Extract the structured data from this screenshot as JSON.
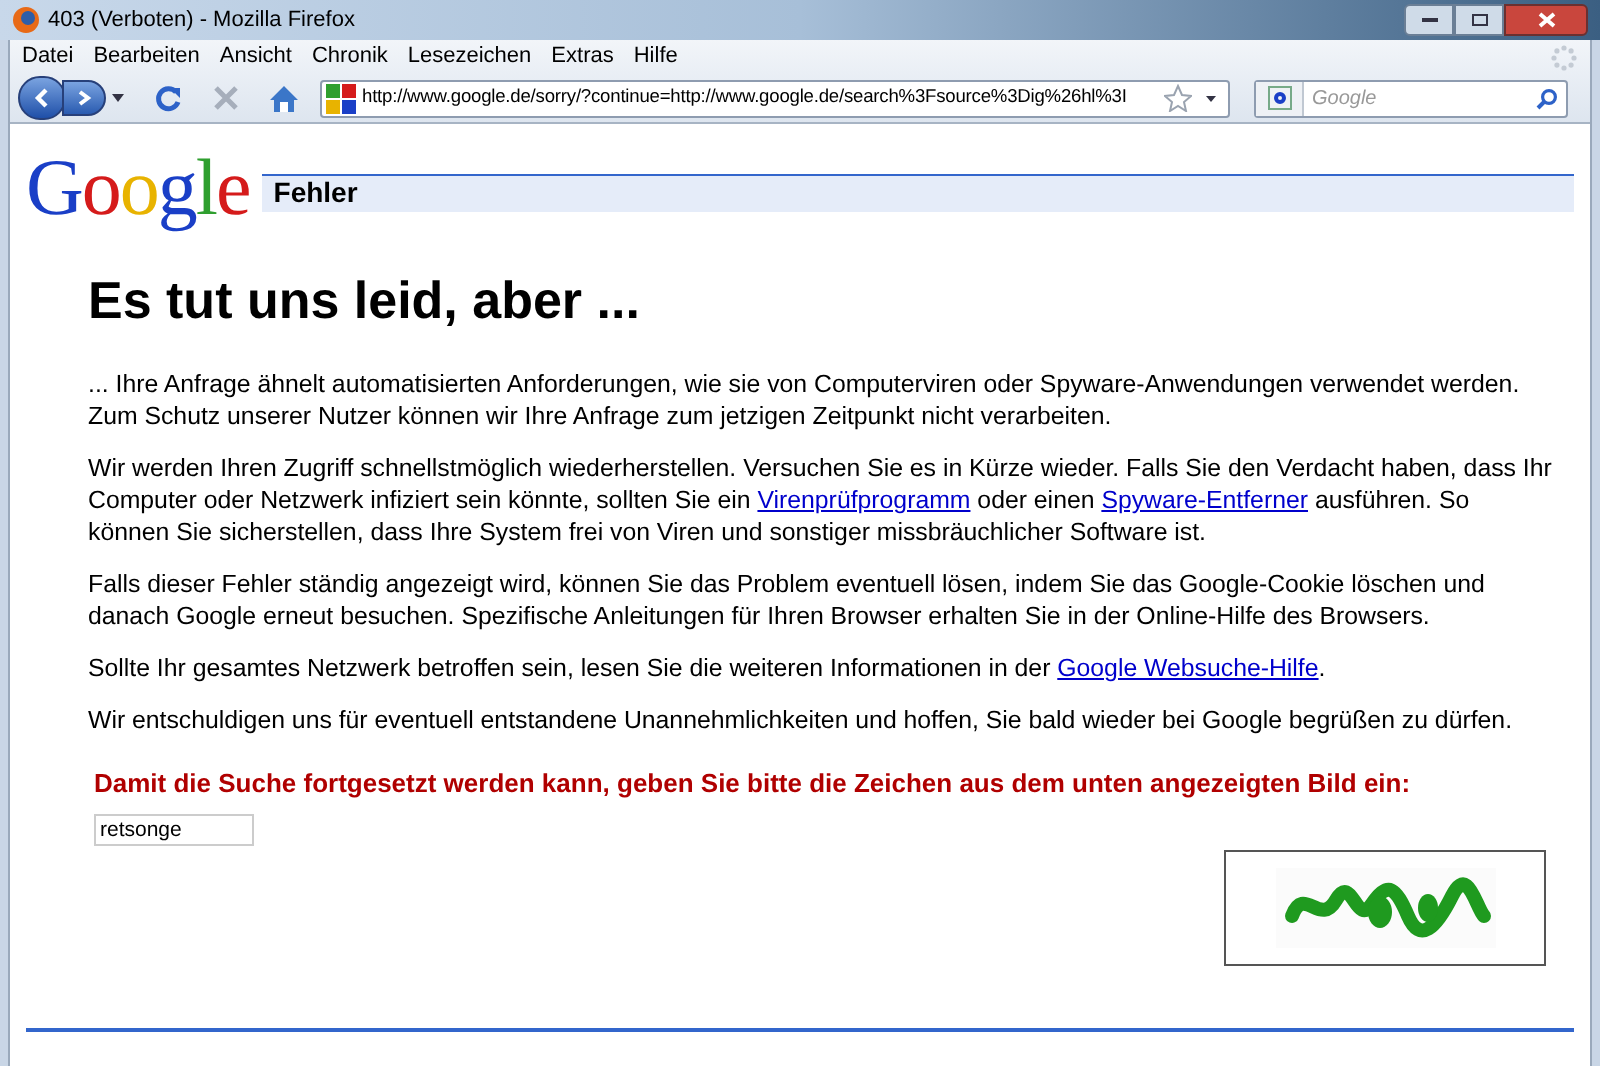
{
  "window": {
    "title": "403 (Verboten) - Mozilla Firefox"
  },
  "menu": [
    "Datei",
    "Bearbeiten",
    "Ansicht",
    "Chronik",
    "Lesezeichen",
    "Extras",
    "Hilfe"
  ],
  "address_bar": {
    "value": "http://www.google.de/sorry/?continue=http://www.google.de/search%3Fsource%3Dig%26hl%3I"
  },
  "search_box": {
    "placeholder": "Google"
  },
  "page": {
    "logo": [
      {
        "char": "G",
        "color": "#1a3fc7"
      },
      {
        "char": "o",
        "color": "#d51b1b"
      },
      {
        "char": "o",
        "color": "#e8b300"
      },
      {
        "char": "g",
        "color": "#1a3fc7"
      },
      {
        "char": "l",
        "color": "#2f9f2f"
      },
      {
        "char": "e",
        "color": "#d51b1b"
      }
    ],
    "header": "Fehler",
    "heading": "Es tut uns leid, aber ...",
    "paragraphs": [
      {
        "parts": [
          {
            "text": "... Ihre Anfrage ähnelt automatisierten Anforderungen, wie sie von Computerviren oder Spyware-Anwendungen verwendet werden. Zum Schutz unserer Nutzer können wir Ihre Anfrage zum jetzigen Zeitpunkt nicht verarbeiten."
          }
        ]
      },
      {
        "parts": [
          {
            "text": "Wir werden Ihren Zugriff schnellstmöglich wiederherstellen. Versuchen Sie es in Kürze wieder. Falls Sie den Verdacht haben, dass Ihr Computer oder Netzwerk infiziert sein könnte, sollten Sie ein "
          },
          {
            "text": "Virenprüfprogramm",
            "link": true
          },
          {
            "text": " oder einen "
          },
          {
            "text": "Spyware-Entferner",
            "link": true
          },
          {
            "text": " ausführen. So können Sie sicherstellen, dass Ihre System frei von Viren und sonstiger missbräuchlicher Software ist."
          }
        ]
      },
      {
        "parts": [
          {
            "text": "Falls dieser Fehler ständig angezeigt wird, können Sie das Problem eventuell lösen, indem Sie das Google-Cookie löschen und danach Google erneut besuchen. Spezifische Anleitungen für Ihren Browser erhalten Sie in der Online-Hilfe des Browsers."
          }
        ]
      },
      {
        "parts": [
          {
            "text": "Sollte Ihr gesamtes Netzwerk betroffen sein, lesen Sie die weiteren Informationen in der "
          },
          {
            "text": "Google Websuche-Hilfe",
            "link": true
          },
          {
            "text": "."
          }
        ]
      },
      {
        "parts": [
          {
            "text": "Wir entschuldigen uns für eventuell entstandene Unannehmlichkeiten und hoffen, Sie bald wieder bei Google begrüßen zu dürfen."
          }
        ]
      }
    ],
    "captcha_prompt": "Damit die Suche fortgesetzt werden kann, geben Sie bitte die Zeichen aus dem unten angezeigten Bild ein:",
    "captcha_field": {
      "value": "retsonge"
    }
  }
}
